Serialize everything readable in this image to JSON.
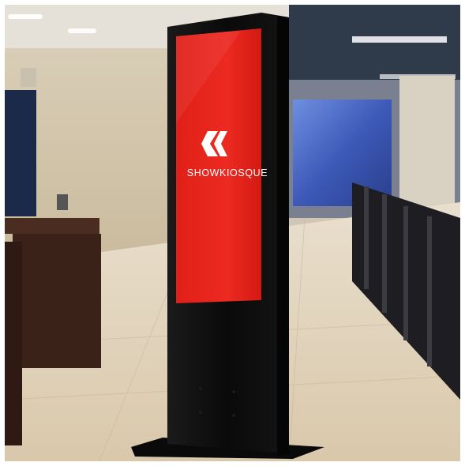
{
  "photo": {
    "subject": "kiosk-photo",
    "kiosk": {
      "brand_name": "SHOWKIOSQUE",
      "screen_color": "#e8231e",
      "body_color": "#0c0c0c"
    }
  }
}
